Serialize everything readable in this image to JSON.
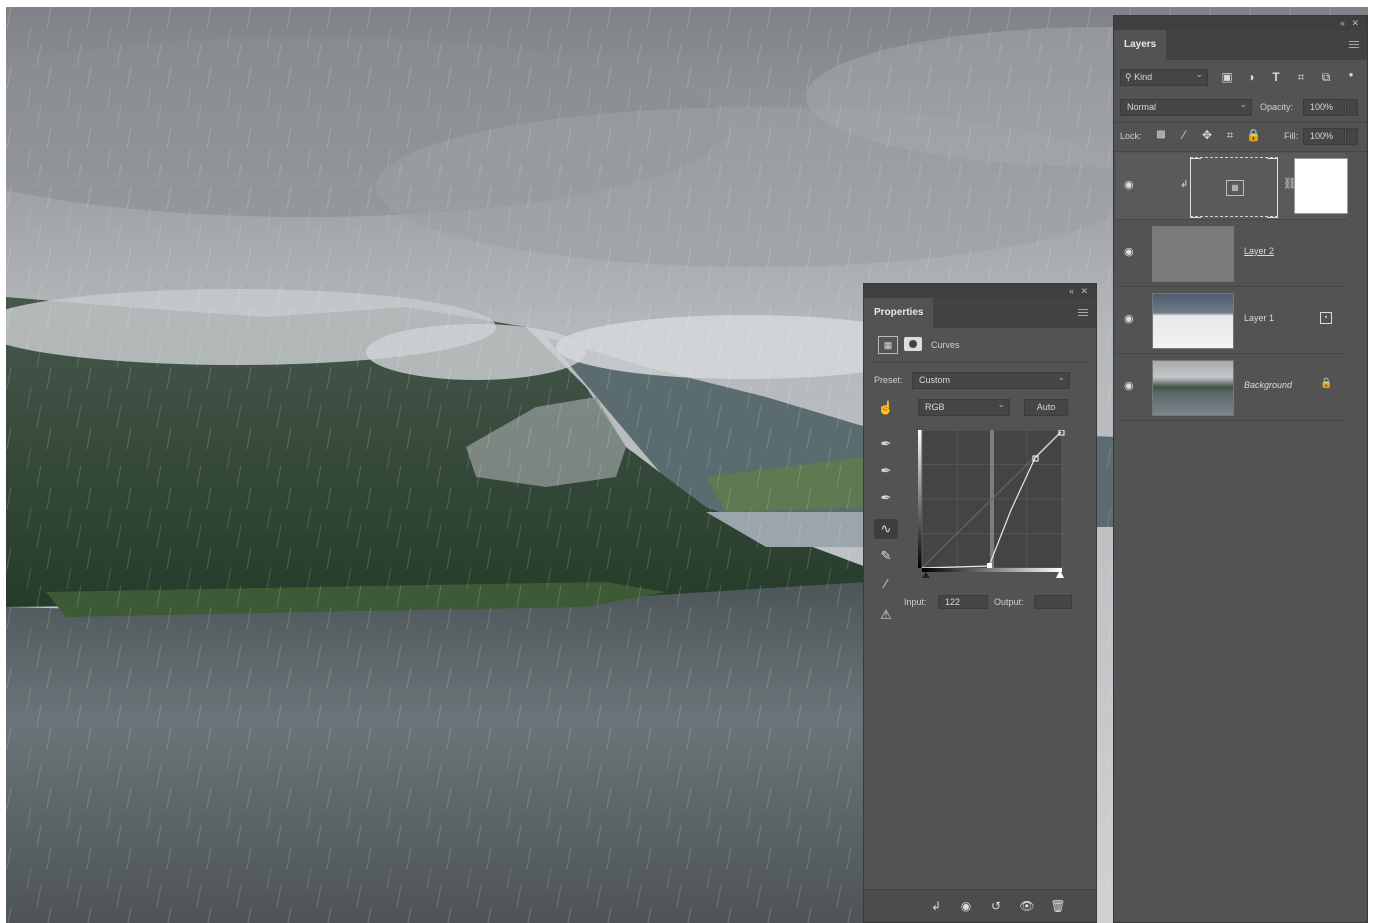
{
  "properties": {
    "title": "Properties",
    "panel_type": "Curves",
    "preset_label": "Preset:",
    "preset_value": "Custom",
    "channel_value": "RGB",
    "auto_label": "Auto",
    "input_label": "Input:",
    "input_value": "122",
    "output_label": "Output:",
    "output_value": "",
    "icons": [
      "adjustment-icon",
      "mask-icon",
      "targeted-adjustment-icon",
      "black-eyedropper-icon",
      "gray-eyedropper-icon",
      "white-eyedropper-icon",
      "curve-point-icon",
      "pencil-icon",
      "smooth-icon",
      "clipping-warning-icon",
      "clip-to-layer-icon",
      "view-previous-icon",
      "reset-icon",
      "visibility-icon",
      "trash-icon"
    ]
  },
  "layers": {
    "title": "Layers",
    "filter_label": "Kind",
    "blend_mode": "Normal",
    "opacity_label": "Opacity:",
    "opacity_value": "100%",
    "lock_label": "Lock:",
    "fill_label": "Fill:",
    "fill_value": "100%",
    "items": [
      {
        "name": "",
        "type": "curves-adjustment",
        "selected": true
      },
      {
        "name": "Layer 2",
        "type": "pixel"
      },
      {
        "name": "Layer 1",
        "type": "smart-object"
      },
      {
        "name": "Background",
        "type": "background",
        "locked": true
      }
    ]
  },
  "colors": {
    "panel_bg": "#535353",
    "panel_dark": "#424242",
    "field_bg": "#454545"
  }
}
